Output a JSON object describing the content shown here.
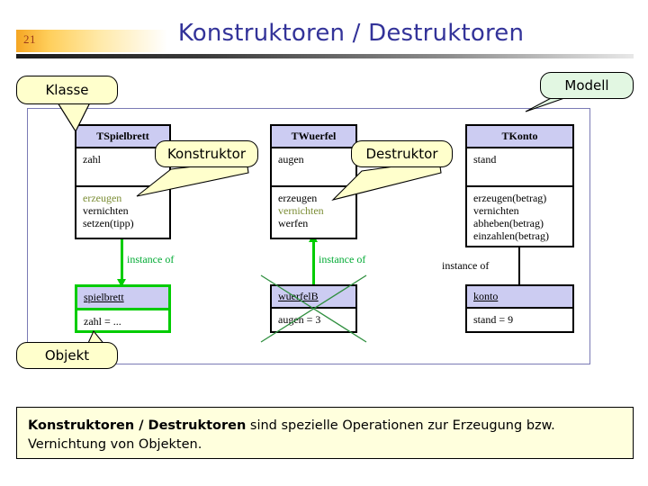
{
  "header": {
    "slide_number": "21",
    "title": "Konstruktoren / Destruktoren"
  },
  "callouts": {
    "klasse": "Klasse",
    "modell": "Modell",
    "objekt": "Objekt",
    "konstruktor": "Konstruktor",
    "destruktor": "Destruktor"
  },
  "classes": [
    {
      "name": "TSpielbrett",
      "attributes": [
        "zahl"
      ],
      "operations": [
        {
          "label": "erzeugen",
          "highlight": true
        },
        {
          "label": "vernichten",
          "highlight": false
        },
        {
          "label": "setzen(tipp)",
          "highlight": false
        }
      ]
    },
    {
      "name": "TWuerfel",
      "attributes": [
        "augen"
      ],
      "operations": [
        {
          "label": "erzeugen",
          "highlight": false
        },
        {
          "label": "vernichten",
          "highlight": true
        },
        {
          "label": "werfen",
          "highlight": false
        }
      ]
    },
    {
      "name": "TKonto",
      "attributes": [
        "stand"
      ],
      "operations": [
        {
          "label": "erzeugen(betrag)",
          "highlight": false
        },
        {
          "label": "vernichten",
          "highlight": false
        },
        {
          "label": "abheben(betrag)",
          "highlight": false
        },
        {
          "label": "einzahlen(betrag)",
          "highlight": false
        }
      ]
    }
  ],
  "instances": [
    {
      "name": "spielbrett",
      "value": "zahl = ...",
      "relation": "instance of",
      "deleted": false,
      "created": true
    },
    {
      "name": "wuerfelB",
      "value": "augen = 3",
      "relation": "instance of",
      "deleted": true,
      "created": false
    },
    {
      "name": "konto",
      "value": "stand = 9",
      "relation": "instance of",
      "deleted": false,
      "created": false
    }
  ],
  "note": {
    "bold": "Konstruktoren / Destruktoren",
    "rest": " sind spezielle Operationen zur Erzeugung bzw. Vernichtung von Objekten."
  },
  "colors": {
    "title": "#333399",
    "class_header": "#ccccf2",
    "highlight_op": "#7a8c33",
    "create_green": "#00cc00",
    "callout_yellow": "#ffffcc",
    "callout_green": "#e2f7e2",
    "note_bg": "#ffffdd",
    "frame_border": "#7b7bb5"
  }
}
